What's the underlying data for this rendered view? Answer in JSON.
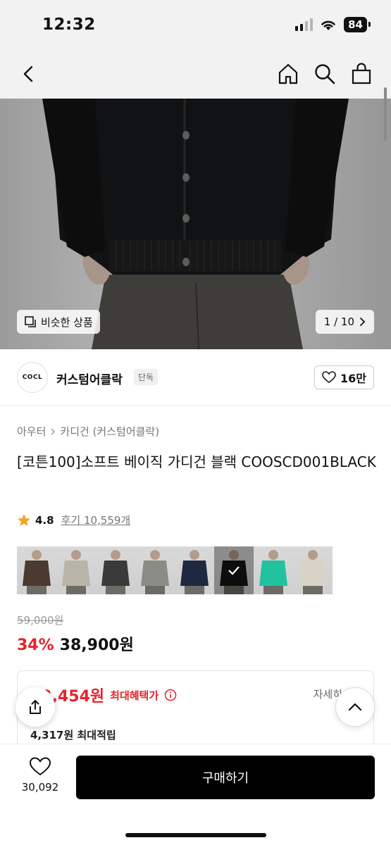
{
  "status_bar": {
    "time": "12:32",
    "battery": "84"
  },
  "nav": {
    "back_icon": "chevron-left-icon",
    "home_icon": "home-icon",
    "search_icon": "search-icon",
    "bag_icon": "shopping-bag-icon"
  },
  "hero": {
    "similar_label": "비슷한 상품",
    "image_counter": "1 / 10"
  },
  "brand": {
    "logo_text": "COCL",
    "name": "커스텀어클락",
    "tag": "단독",
    "likes": "16만"
  },
  "breadcrumb": {
    "category": "아우터",
    "subcategory": "카디건 (커스텀어클락)"
  },
  "product": {
    "title": "[코튼100]소프트 베이직 가디건 블랙 COOSCD001BLACK",
    "rating": "4.8",
    "reviews": "후기 10,559개"
  },
  "swatches": [
    {
      "name": "brown",
      "color": "#4a3a30"
    },
    {
      "name": "oatmeal",
      "color": "#b9b4a7"
    },
    {
      "name": "charcoal",
      "color": "#3a3a3a"
    },
    {
      "name": "grey",
      "color": "#8c8c86"
    },
    {
      "name": "navy",
      "color": "#1e2840"
    },
    {
      "name": "black",
      "color": "#151515",
      "selected": true
    },
    {
      "name": "green",
      "color": "#22c2a0"
    },
    {
      "name": "ivory",
      "color": "#d9d3c7"
    }
  ],
  "price": {
    "original": "59,000원",
    "discount": "34%",
    "sale": "38,900원"
  },
  "benefit": {
    "price": "32,454원",
    "label": "최대혜택가",
    "detail": "자세히",
    "points": "4,317원 최대적립"
  },
  "bottom": {
    "wish_count": "30,092",
    "buy_label": "구매하기"
  },
  "colors": {
    "sale_red": "#e8222b",
    "primary": "#000000"
  }
}
